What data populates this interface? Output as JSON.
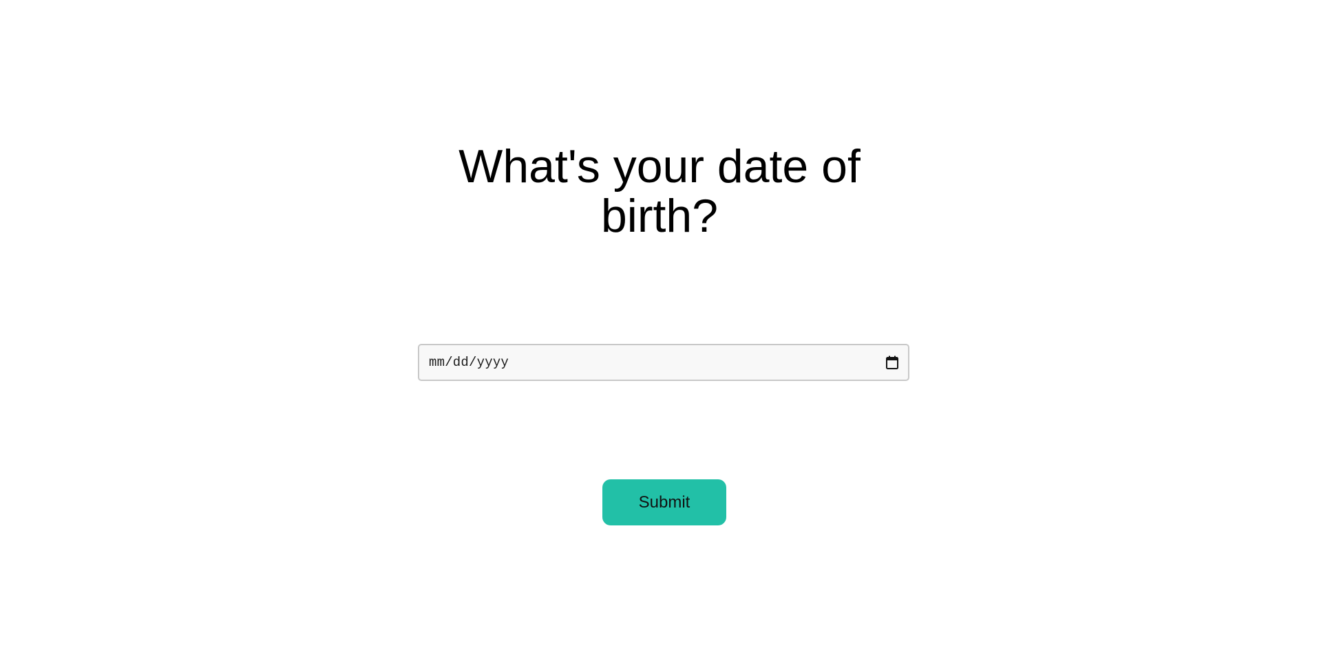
{
  "question": {
    "title": "What's your date of birth?"
  },
  "date_input": {
    "placeholder": "mm/dd/yyyy",
    "value": "",
    "icon": "calendar-icon"
  },
  "submit": {
    "label": "Submit"
  },
  "colors": {
    "accent": "#22c0a7",
    "field_background": "#f8f8f8",
    "field_border": "#c8c8c8",
    "page_background": "#ffffff"
  }
}
